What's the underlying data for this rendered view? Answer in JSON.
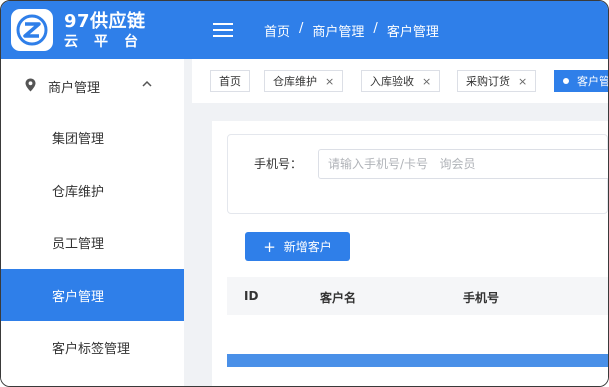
{
  "header": {
    "brand_name": "97供应链",
    "brand_sub": "云平台",
    "breadcrumb": [
      "首页",
      "/",
      "商户管理",
      "/",
      "客户管理"
    ],
    "accent_color": "#2f7fe9"
  },
  "sidebar": {
    "group_label": "商户管理",
    "group_icon": "location-pin-icon",
    "items": [
      {
        "label": "集团管理"
      },
      {
        "label": "仓库维护"
      },
      {
        "label": "员工管理"
      },
      {
        "label": "客户管理",
        "active": true
      },
      {
        "label": "客户标签管理"
      }
    ]
  },
  "tabs": [
    {
      "label": "首页",
      "closable": false
    },
    {
      "label": "仓库维护",
      "closable": true
    },
    {
      "label": "入库验收",
      "closable": true
    },
    {
      "label": "采购订货",
      "closable": true
    },
    {
      "label": "客户管",
      "active": true
    }
  ],
  "tab_close_glyph": "×",
  "search": {
    "phone_label": "手机号：",
    "phone_placeholder": "请输入手机号/卡号   询会员"
  },
  "actions": {
    "add_customer": "新增客户",
    "add_glyph": "+"
  },
  "table": {
    "columns": [
      "ID",
      "客户名",
      "手机号"
    ]
  }
}
